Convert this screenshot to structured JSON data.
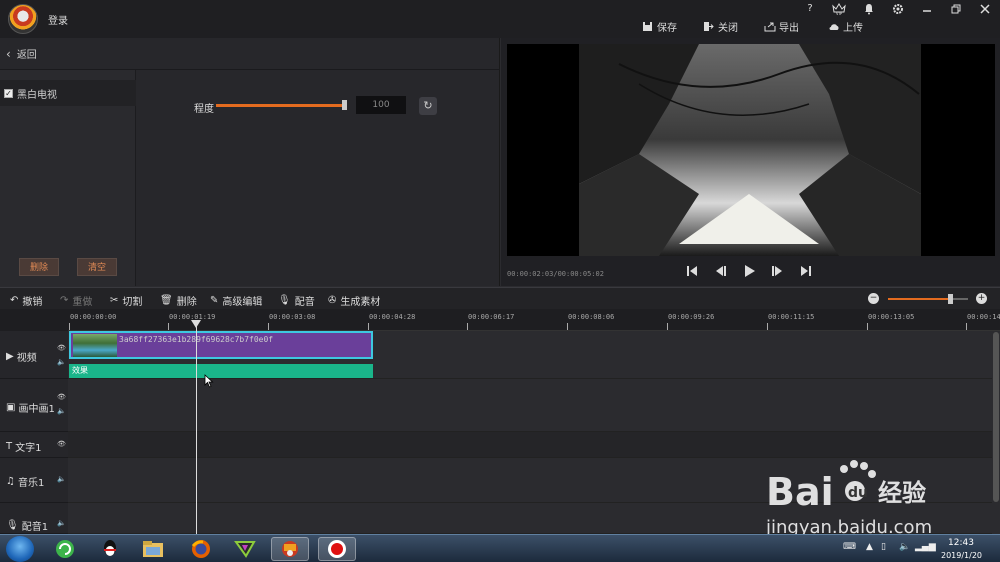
{
  "top": {
    "login_label": "登录",
    "save_label": "保存",
    "close_label": "关闭",
    "export_label": "导出",
    "upload_label": "上传",
    "vip_label": "VIP",
    "help_label": "?"
  },
  "left": {
    "back_label": "返回",
    "effect_name": "黑白电视",
    "delete_label": "删除",
    "clear_label": "清空",
    "degree_label": "程度",
    "degree_value": "100",
    "degree_level": 1.0
  },
  "preview": {
    "timecode": "00:00:02:03/00:00:05:02"
  },
  "toolbar": {
    "undo": "撤销",
    "redo": "重做",
    "cut": "切割",
    "delete": "删除",
    "advanced_edit": "高级编辑",
    "dub": "配音",
    "generate": "生成素材",
    "zoom_level": 0.78
  },
  "ruler": {
    "labels": [
      "00:00:00:00",
      "00:00:01:19",
      "00:00:03:08",
      "00:00:04:28",
      "00:00:06:17",
      "00:00:08:06",
      "00:00:09:26",
      "00:00:11:15",
      "00:00:13:05",
      "00:00:14:"
    ]
  },
  "tracks": {
    "video": "视频",
    "pip": "画中画1",
    "text": "文字1",
    "music": "音乐1",
    "voice": "配音1"
  },
  "clip": {
    "name": "3a68ff27363e1b289f69628c7b7f0e0f",
    "effect_label": "效果"
  },
  "taskbar": {
    "time": "12:43",
    "date": "2019/1/20"
  },
  "watermark": {
    "brand": "Bai",
    "brand2": "du",
    "cn": "经验",
    "url": "jingyan.baidu.com"
  },
  "colors": {
    "accent": "#e36b1f",
    "clip": "#6a3f9a",
    "clip_border": "#3ec8e0",
    "effect": "#1ab58a"
  }
}
